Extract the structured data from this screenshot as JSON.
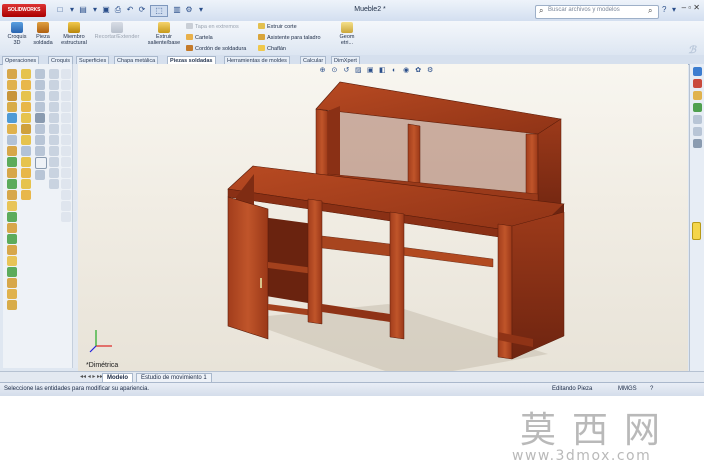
{
  "window": {
    "doc_title": "Mueble2 *",
    "search_placeholder": "Buscar archivos y modelos",
    "logo_text": "SOLIDWORKS"
  },
  "ribbon": {
    "buttons": [
      {
        "label": "Croquis\n3D",
        "icon": "sketch3d-icon",
        "enabled": true
      },
      {
        "label": "Pieza\nsoldada",
        "icon": "weldment-icon",
        "enabled": true
      },
      {
        "label": "Miembro\nestructural",
        "icon": "structural-member-icon",
        "enabled": true
      },
      {
        "label": "Recortar/Extender",
        "icon": "trim-extend-icon",
        "enabled": false
      },
      {
        "label": "Extruir\nsaliente/base",
        "icon": "extrude-boss-icon",
        "enabled": true
      }
    ],
    "small_items_col1": [
      {
        "label": "Tapa en extremos",
        "icon": "end-cap-icon",
        "enabled": false
      },
      {
        "label": "Cartela",
        "icon": "gusset-icon",
        "enabled": true
      },
      {
        "label": "Cordón de soldadura",
        "icon": "weld-bead-icon",
        "enabled": true
      }
    ],
    "small_items_col2": [
      {
        "label": "Extruir corte",
        "icon": "extrude-cut-icon",
        "enabled": true
      },
      {
        "label": "Asistente para taladro",
        "icon": "hole-wizard-icon",
        "enabled": true
      },
      {
        "label": "Chaflán",
        "icon": "chamfer-icon",
        "enabled": true
      }
    ],
    "geom_button": {
      "label": "Geom\netri...",
      "icon": "reference-geometry-icon"
    }
  },
  "tabs": [
    "Operaciones",
    "Croquis",
    "Superficies",
    "Chapa metálica",
    "Piezas soldadas",
    "Herramientas de moldes",
    "Calcular",
    "DimXpert"
  ],
  "active_tab": "Piezas soldadas",
  "viewport": {
    "view_label": "*Dimétrica",
    "heads_up_icons": [
      "zoom-fit-icon",
      "zoom-area-icon",
      "previous-view-icon",
      "section-view-icon",
      "view-orientation-icon",
      "display-style-icon",
      "hide-show-icon",
      "edit-appearance-icon",
      "scene-icon",
      "view-settings-icon"
    ],
    "wood_color": "#8c2d12"
  },
  "bottom_tabs": [
    "Modelo",
    "Estudio de movimiento 1"
  ],
  "active_bottom_tab": "Modelo",
  "status": {
    "message": "Seleccione las entidades para modificar su apariencia.",
    "mode": "Editando Pieza",
    "units": "MMGS"
  },
  "watermark": {
    "chinese": "莫西网",
    "url": "www.3dmox.com"
  }
}
